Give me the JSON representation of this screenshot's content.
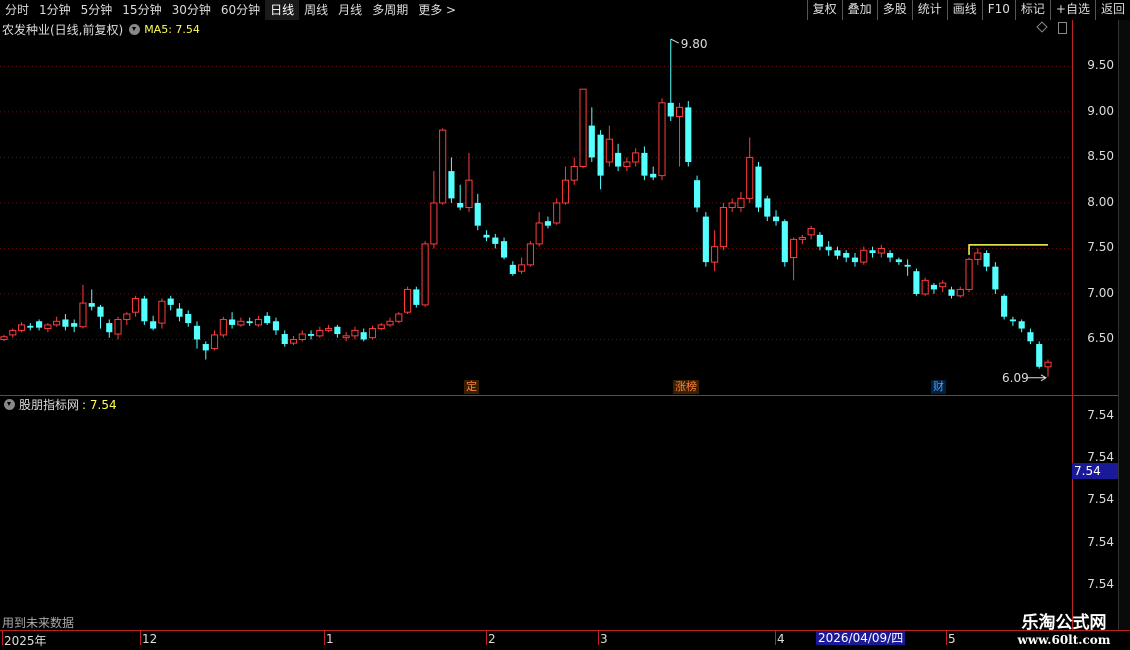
{
  "toolbar": {
    "tabs": [
      "分时",
      "1分钟",
      "5分钟",
      "15分钟",
      "30分钟",
      "60分钟",
      "日线",
      "周线",
      "月线",
      "多周期",
      "更多 >"
    ],
    "active_tab": "日线",
    "tools": [
      "复权",
      "叠加",
      "多股",
      "统计",
      "画线",
      "F10",
      "标记",
      "+自选",
      "返回"
    ]
  },
  "main": {
    "title": "农发种业(日线,前复权)",
    "ma_label": "MA5: 7.54",
    "price_labels": [
      "9.50",
      "9.00",
      "8.50",
      "8.00",
      "7.50",
      "7.00",
      "6.50"
    ],
    "high_label": "9.80",
    "low_label": "6.09",
    "markers": [
      {
        "text": "定",
        "color": "#ff8040"
      },
      {
        "text": "涨榜",
        "color": "#ff8040"
      },
      {
        "text": "财",
        "color": "#5599ff"
      }
    ]
  },
  "indicator": {
    "name": "股朋指标网",
    "value": ": 7.54",
    "axis_labels": [
      "7.54",
      "7.54",
      "7.54",
      "7.54",
      "7.54"
    ],
    "current": "7.54"
  },
  "footer": {
    "future_note": "用到未来数据",
    "dates": [
      "2025年",
      "12",
      "1",
      "2",
      "3",
      "4",
      "2026/04/09/四",
      "5"
    ]
  },
  "watermark": {
    "cn": "乐淘公式网",
    "url": "www.60lt.com"
  },
  "colors": {
    "up": "#ff3c3c",
    "down": "#54ffff",
    "axis": "#b22222",
    "ma": "#ffff55"
  },
  "chart_data": {
    "type": "candlestick",
    "ylim": [
      6.0,
      9.9
    ],
    "candles": [
      [
        6.5,
        6.53,
        6.55,
        6.48
      ],
      [
        6.55,
        6.6,
        6.62,
        6.52
      ],
      [
        6.6,
        6.66,
        6.69,
        6.58
      ],
      [
        6.65,
        6.63,
        6.68,
        6.6
      ],
      [
        6.7,
        6.63,
        6.72,
        6.6
      ],
      [
        6.62,
        6.66,
        6.68,
        6.58
      ],
      [
        6.66,
        6.7,
        6.75,
        6.64
      ],
      [
        6.72,
        6.64,
        6.78,
        6.6
      ],
      [
        6.68,
        6.64,
        6.72,
        6.58
      ],
      [
        6.64,
        6.9,
        7.1,
        6.62
      ],
      [
        6.9,
        6.86,
        7.05,
        6.82
      ],
      [
        6.86,
        6.75,
        6.88,
        6.62
      ],
      [
        6.68,
        6.58,
        6.72,
        6.52
      ],
      [
        6.56,
        6.72,
        6.75,
        6.5
      ],
      [
        6.72,
        6.78,
        6.8,
        6.66
      ],
      [
        6.8,
        6.95,
        6.98,
        6.75
      ],
      [
        6.95,
        6.7,
        6.98,
        6.66
      ],
      [
        6.7,
        6.62,
        6.76,
        6.6
      ],
      [
        6.68,
        6.92,
        6.95,
        6.62
      ],
      [
        6.95,
        6.88,
        6.98,
        6.82
      ],
      [
        6.84,
        6.75,
        6.9,
        6.7
      ],
      [
        6.78,
        6.68,
        6.82,
        6.64
      ],
      [
        6.65,
        6.5,
        6.7,
        6.4
      ],
      [
        6.45,
        6.38,
        6.48,
        6.28
      ],
      [
        6.4,
        6.55,
        6.6,
        6.38
      ],
      [
        6.55,
        6.72,
        6.75,
        6.52
      ],
      [
        6.72,
        6.66,
        6.8,
        6.62
      ],
      [
        6.66,
        6.7,
        6.74,
        6.64
      ],
      [
        6.7,
        6.68,
        6.74,
        6.65
      ],
      [
        6.66,
        6.72,
        6.76,
        6.64
      ],
      [
        6.76,
        6.68,
        6.8,
        6.66
      ],
      [
        6.7,
        6.6,
        6.74,
        6.55
      ],
      [
        6.56,
        6.45,
        6.6,
        6.42
      ],
      [
        6.46,
        6.5,
        6.54,
        6.44
      ],
      [
        6.5,
        6.56,
        6.6,
        6.48
      ],
      [
        6.56,
        6.54,
        6.6,
        6.5
      ],
      [
        6.54,
        6.6,
        6.64,
        6.52
      ],
      [
        6.6,
        6.62,
        6.66,
        6.58
      ],
      [
        6.64,
        6.56,
        6.66,
        6.52
      ],
      [
        6.52,
        6.54,
        6.58,
        6.48
      ],
      [
        6.54,
        6.6,
        6.64,
        6.5
      ],
      [
        6.58,
        6.5,
        6.62,
        6.48
      ],
      [
        6.52,
        6.62,
        6.65,
        6.5
      ],
      [
        6.62,
        6.66,
        6.68,
        6.6
      ],
      [
        6.66,
        6.7,
        6.74,
        6.64
      ],
      [
        6.7,
        6.78,
        6.8,
        6.68
      ],
      [
        6.8,
        7.05,
        7.08,
        6.78
      ],
      [
        7.05,
        6.88,
        7.08,
        6.85
      ],
      [
        6.88,
        7.55,
        7.58,
        6.86
      ],
      [
        7.55,
        8.0,
        8.35,
        7.5
      ],
      [
        8.0,
        8.8,
        8.82,
        7.98
      ],
      [
        8.35,
        8.05,
        8.5,
        8.0
      ],
      [
        8.0,
        7.95,
        8.2,
        7.92
      ],
      [
        7.95,
        8.25,
        8.55,
        7.9
      ],
      [
        8.0,
        7.75,
        8.1,
        7.7
      ],
      [
        7.65,
        7.62,
        7.7,
        7.58
      ],
      [
        7.62,
        7.55,
        7.66,
        7.5
      ],
      [
        7.58,
        7.4,
        7.62,
        7.38
      ],
      [
        7.32,
        7.22,
        7.36,
        7.2
      ],
      [
        7.25,
        7.32,
        7.4,
        7.22
      ],
      [
        7.32,
        7.55,
        7.58,
        7.3
      ],
      [
        7.55,
        7.78,
        7.9,
        7.52
      ],
      [
        7.8,
        7.75,
        7.85,
        7.72
      ],
      [
        7.78,
        8.0,
        8.05,
        7.76
      ],
      [
        8.0,
        8.25,
        8.4,
        7.98
      ],
      [
        8.25,
        8.4,
        8.5,
        8.2
      ],
      [
        8.4,
        9.25,
        9.25,
        8.38
      ],
      [
        8.85,
        8.5,
        9.05,
        8.45
      ],
      [
        8.75,
        8.3,
        8.8,
        8.15
      ],
      [
        8.45,
        8.7,
        8.85,
        8.4
      ],
      [
        8.55,
        8.4,
        8.65,
        8.35
      ],
      [
        8.4,
        8.45,
        8.5,
        8.35
      ],
      [
        8.45,
        8.55,
        8.6,
        8.4
      ],
      [
        8.55,
        8.3,
        8.62,
        8.25
      ],
      [
        8.32,
        8.28,
        8.4,
        8.25
      ],
      [
        8.3,
        9.1,
        9.15,
        8.25
      ],
      [
        9.1,
        8.95,
        9.8,
        8.9
      ],
      [
        8.95,
        9.05,
        9.1,
        8.4
      ],
      [
        9.05,
        8.45,
        9.12,
        8.4
      ],
      [
        8.25,
        7.95,
        8.3,
        7.9
      ],
      [
        7.85,
        7.35,
        7.9,
        7.3
      ],
      [
        7.35,
        7.52,
        7.7,
        7.25
      ],
      [
        7.52,
        7.95,
        8.0,
        7.48
      ],
      [
        7.95,
        8.0,
        8.05,
        7.9
      ],
      [
        7.95,
        8.05,
        8.12,
        7.9
      ],
      [
        8.05,
        8.5,
        8.72,
        8.0
      ],
      [
        8.4,
        7.95,
        8.45,
        7.9
      ],
      [
        8.05,
        7.85,
        8.08,
        7.8
      ],
      [
        7.85,
        7.8,
        7.92,
        7.75
      ],
      [
        7.8,
        7.35,
        7.82,
        7.3
      ],
      [
        7.4,
        7.6,
        7.62,
        7.15
      ],
      [
        7.6,
        7.62,
        7.65,
        7.55
      ],
      [
        7.65,
        7.72,
        7.75,
        7.6
      ],
      [
        7.65,
        7.52,
        7.68,
        7.48
      ],
      [
        7.52,
        7.48,
        7.58,
        7.42
      ],
      [
        7.48,
        7.42,
        7.52,
        7.38
      ],
      [
        7.45,
        7.4,
        7.48,
        7.35
      ],
      [
        7.4,
        7.35,
        7.45,
        7.3
      ],
      [
        7.35,
        7.48,
        7.52,
        7.32
      ],
      [
        7.48,
        7.45,
        7.52,
        7.4
      ],
      [
        7.45,
        7.5,
        7.54,
        7.4
      ],
      [
        7.45,
        7.4,
        7.48,
        7.35
      ],
      [
        7.38,
        7.35,
        7.4,
        7.32
      ],
      [
        7.32,
        7.3,
        7.38,
        7.2
      ],
      [
        7.25,
        7.0,
        7.28,
        6.98
      ],
      [
        7.0,
        7.15,
        7.18,
        6.98
      ],
      [
        7.1,
        7.05,
        7.12,
        7.0
      ],
      [
        7.08,
        7.12,
        7.15,
        7.02
      ],
      [
        7.05,
        6.98,
        7.08,
        6.95
      ],
      [
        6.98,
        7.05,
        7.08,
        6.96
      ],
      [
        7.05,
        7.38,
        7.4,
        7.02
      ],
      [
        7.38,
        7.45,
        7.5,
        7.32
      ],
      [
        7.45,
        7.3,
        7.48,
        7.25
      ],
      [
        7.3,
        7.05,
        7.35,
        7.0
      ],
      [
        6.98,
        6.75,
        7.0,
        6.72
      ],
      [
        6.72,
        6.7,
        6.75,
        6.65
      ],
      [
        6.7,
        6.62,
        6.72,
        6.58
      ],
      [
        6.58,
        6.48,
        6.62,
        6.45
      ],
      [
        6.45,
        6.2,
        6.48,
        6.18
      ],
      [
        6.2,
        6.25,
        6.28,
        6.09
      ]
    ],
    "ma5_line": {
      "from_index": 110,
      "to_index": 119,
      "value": 7.54
    }
  }
}
